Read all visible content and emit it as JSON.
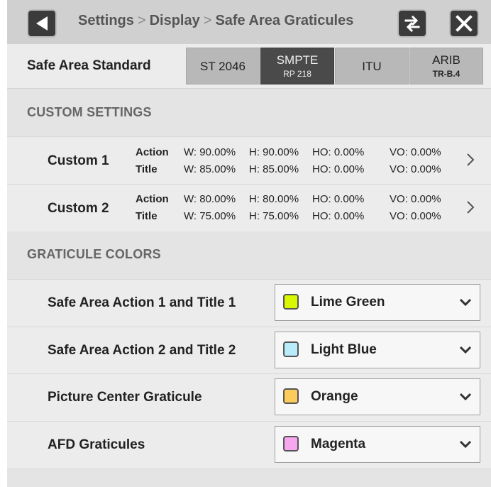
{
  "header": {
    "breadcrumb": [
      "Settings",
      "Display",
      "Safe Area Graticules"
    ],
    "separator": ">",
    "icons": {
      "back": "back-arrow-icon",
      "swap": "swap-icon",
      "close": "close-icon"
    }
  },
  "standard": {
    "label": "Safe Area Standard",
    "options": [
      {
        "main": "ST 2046",
        "sub": "",
        "active": false
      },
      {
        "main": "SMPTE",
        "sub": "RP 218",
        "active": true
      },
      {
        "main": "ITU",
        "sub": "",
        "active": false
      },
      {
        "main": "ARIB",
        "sub": "TR-B.4",
        "active": false
      }
    ]
  },
  "custom_settings": {
    "heading": "CUSTOM SETTINGS",
    "items": [
      {
        "name": "Custom 1",
        "action": {
          "label": "Action",
          "w": "W: 90.00%",
          "h": "H: 90.00%",
          "ho": "HO: 0.00%",
          "vo": "VO: 0.00%"
        },
        "title": {
          "label": "Title",
          "w": "W: 85.00%",
          "h": "H: 85.00%",
          "ho": "HO: 0.00%",
          "vo": "VO: 0.00%"
        }
      },
      {
        "name": "Custom 2",
        "action": {
          "label": "Action",
          "w": "W: 80.00%",
          "h": "H: 80.00%",
          "ho": "HO: 0.00%",
          "vo": "VO: 0.00%"
        },
        "title": {
          "label": "Title",
          "w": "W: 75.00%",
          "h": "H: 75.00%",
          "ho": "HO: 0.00%",
          "vo": "VO: 0.00%"
        }
      }
    ]
  },
  "graticule_colors": {
    "heading": "GRATICULE COLORS",
    "items": [
      {
        "label": "Safe Area Action 1 and Title 1",
        "value": "Lime Green",
        "color": "#d8f700"
      },
      {
        "label": "Safe Area Action 2 and Title 2",
        "value": "Light Blue",
        "color": "#b8ecfb"
      },
      {
        "label": "Picture Center Graticule",
        "value": "Orange",
        "color": "#fbcb5c"
      },
      {
        "label": "AFD Graticules",
        "value": "Magenta",
        "color": "#f7a6f0"
      }
    ]
  },
  "colors": {
    "active_button": "#4a4a4a",
    "inactive_button": "#b8b8b8",
    "panel_bg": "#ececec"
  }
}
